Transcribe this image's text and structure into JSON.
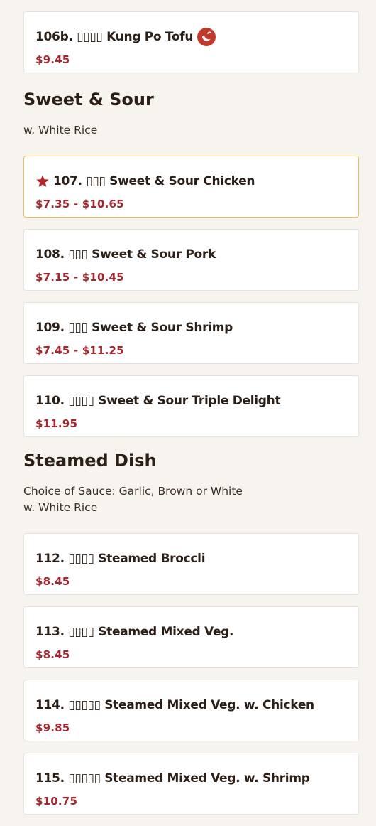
{
  "top_item": {
    "name": "106b. ▯▯▯▯ Kung Po Tofu",
    "price": "$9.45",
    "icon": "chili-pepper-icon"
  },
  "sweet_sour": {
    "title": "Sweet & Sour",
    "desc": [
      "w. White Rice"
    ],
    "items": [
      {
        "name": "107. ▯▯▯ Sweet & Sour Chicken",
        "price": "$7.35 - $10.65",
        "featured": true,
        "icon": "star-icon"
      },
      {
        "name": "108. ▯▯▯ Sweet & Sour Pork",
        "price": "$7.15 - $10.45"
      },
      {
        "name": "109. ▯▯▯ Sweet & Sour Shrimp",
        "price": "$7.45 - $11.25"
      },
      {
        "name": "110. ▯▯▯▯ Sweet & Sour Triple Delight",
        "price": "$11.95"
      }
    ]
  },
  "steamed": {
    "title": "Steamed Dish",
    "desc": [
      "Choice of Sauce: Garlic, Brown or White",
      "w. White Rice"
    ],
    "items": [
      {
        "name": "112. ▯▯▯▯ Steamed Broccli",
        "price": "$8.45"
      },
      {
        "name": "113. ▯▯▯▯ Steamed Mixed Veg.",
        "price": "$8.45"
      },
      {
        "name": "114. ▯▯▯▯▯ Steamed Mixed Veg. w. Chicken",
        "price": "$9.85"
      },
      {
        "name": "115. ▯▯▯▯▯ Steamed Mixed Veg. w. Shrimp",
        "price": "$10.75"
      }
    ]
  },
  "colors": {
    "price": "#a5272d",
    "featured_border": "#e6c15a",
    "accent_icon": "#c0392b"
  }
}
